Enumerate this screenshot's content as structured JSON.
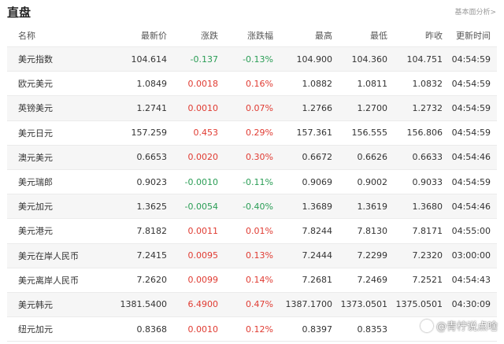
{
  "page": {
    "title": "直盘",
    "more_link": "基本面分析>"
  },
  "colors": {
    "up": "#e03b32",
    "down": "#2a9d55"
  },
  "table": {
    "headers": [
      "名称",
      "最新价",
      "涨跌",
      "涨跌幅",
      "最高",
      "最低",
      "昨收",
      "更新时间"
    ],
    "rows": [
      {
        "name": "美元指数",
        "latest": "104.614",
        "change": "-0.137",
        "pct": "-0.13%",
        "high": "104.900",
        "low": "104.360",
        "prev": "104.751",
        "time": "04:54:59",
        "dir": "down"
      },
      {
        "name": "欧元美元",
        "latest": "1.0849",
        "change": "0.0018",
        "pct": "0.16%",
        "high": "1.0882",
        "low": "1.0811",
        "prev": "1.0832",
        "time": "04:54:59",
        "dir": "up"
      },
      {
        "name": "英镑美元",
        "latest": "1.2741",
        "change": "0.0010",
        "pct": "0.07%",
        "high": "1.2766",
        "low": "1.2700",
        "prev": "1.2732",
        "time": "04:54:59",
        "dir": "up"
      },
      {
        "name": "美元日元",
        "latest": "157.259",
        "change": "0.453",
        "pct": "0.29%",
        "high": "157.361",
        "low": "156.555",
        "prev": "156.806",
        "time": "04:54:59",
        "dir": "up"
      },
      {
        "name": "澳元美元",
        "latest": "0.6653",
        "change": "0.0020",
        "pct": "0.30%",
        "high": "0.6672",
        "low": "0.6626",
        "prev": "0.6633",
        "time": "04:54:46",
        "dir": "up"
      },
      {
        "name": "美元瑞郎",
        "latest": "0.9023",
        "change": "-0.0010",
        "pct": "-0.11%",
        "high": "0.9069",
        "low": "0.9002",
        "prev": "0.9033",
        "time": "04:54:59",
        "dir": "down"
      },
      {
        "name": "美元加元",
        "latest": "1.3625",
        "change": "-0.0054",
        "pct": "-0.40%",
        "high": "1.3689",
        "low": "1.3619",
        "prev": "1.3680",
        "time": "04:54:46",
        "dir": "down"
      },
      {
        "name": "美元港元",
        "latest": "7.8182",
        "change": "0.0011",
        "pct": "0.01%",
        "high": "7.8244",
        "low": "7.8130",
        "prev": "7.8171",
        "time": "04:55:00",
        "dir": "up"
      },
      {
        "name": "美元在岸人民币",
        "latest": "7.2415",
        "change": "0.0095",
        "pct": "0.13%",
        "high": "7.2444",
        "low": "7.2299",
        "prev": "7.2320",
        "time": "03:00:00",
        "dir": "up"
      },
      {
        "name": "美元离岸人民币",
        "latest": "7.2620",
        "change": "0.0099",
        "pct": "0.14%",
        "high": "7.2681",
        "low": "7.2469",
        "prev": "7.2521",
        "time": "04:54:43",
        "dir": "up"
      },
      {
        "name": "美元韩元",
        "latest": "1381.5400",
        "change": "6.4900",
        "pct": "0.47%",
        "high": "1387.1700",
        "low": "1373.0501",
        "prev": "1375.0501",
        "time": "04:30:09",
        "dir": "up"
      },
      {
        "name": "纽元加元",
        "latest": "0.8368",
        "change": "0.0010",
        "pct": "0.12%",
        "high": "0.8397",
        "low": "0.8353",
        "prev": "",
        "time": "",
        "dir": "up"
      }
    ]
  },
  "watermark": {
    "text": "@青柠说点啥",
    "icon": "circle-logo-icon"
  }
}
